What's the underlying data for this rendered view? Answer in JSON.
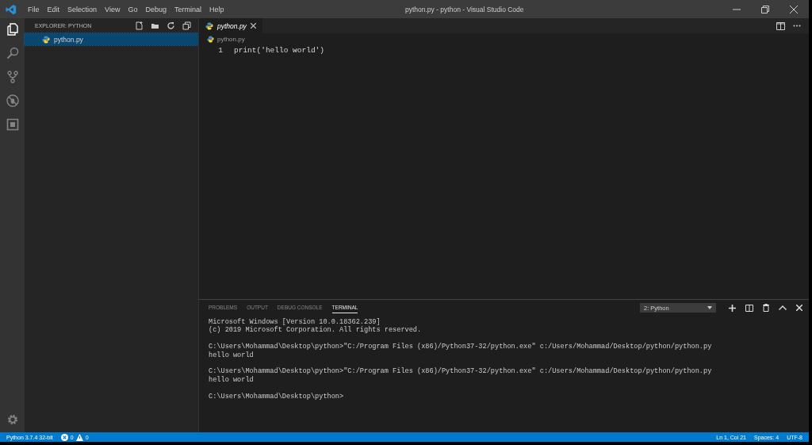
{
  "menu": [
    "File",
    "Edit",
    "Selection",
    "View",
    "Go",
    "Debug",
    "Terminal",
    "Help"
  ],
  "window": {
    "title": "python.py - python - Visual Studio Code"
  },
  "activity": [
    {
      "kind": "files",
      "selected": true
    },
    {
      "kind": "search",
      "selected": false
    },
    {
      "kind": "git",
      "selected": false
    },
    {
      "kind": "debug",
      "selected": false
    },
    {
      "kind": "extensions",
      "selected": false
    }
  ],
  "sidebar": {
    "title": "EXPLORER: PYTHON",
    "items": [
      {
        "label": "python.py",
        "selected": true
      }
    ]
  },
  "tabs": [
    {
      "label": "python.py",
      "selected": true
    }
  ],
  "breadcrumb": "python.py",
  "code": [
    {
      "number": "1",
      "text": "print('hello world')"
    }
  ],
  "panel": {
    "tabs": [
      {
        "label": "PROBLEMS",
        "selected": false
      },
      {
        "label": "OUTPUT",
        "selected": false
      },
      {
        "label": "DEBUG CONSOLE",
        "selected": false
      },
      {
        "label": "TERMINAL",
        "selected": true
      }
    ],
    "terminal_select": "2: Python",
    "blocks": [
      [
        "Microsoft Windows [Version 10.0.18362.239]",
        "(c) 2019 Microsoft Corporation. All rights reserved."
      ],
      [
        "C:\\Users\\Mohammad\\Desktop\\python>\"C:/Program Files (x86)/Python37-32/python.exe\" c:/Users/Mohammad/Desktop/python/python.py",
        "hello world"
      ],
      [
        "C:\\Users\\Mohammad\\Desktop\\python>\"C:/Program Files (x86)/Python37-32/python.exe\" c:/Users/Mohammad/Desktop/python/python.py",
        "hello world"
      ],
      [
        "C:\\Users\\Mohammad\\Desktop\\python>"
      ]
    ]
  },
  "status_bar": {
    "interpreter": "Python 3.7.4 32-bit",
    "errors": "0",
    "warnings": "0",
    "position": "Ln 1, Col 21",
    "spaces": "Spaces: 4",
    "encoding": "UTF-8"
  }
}
